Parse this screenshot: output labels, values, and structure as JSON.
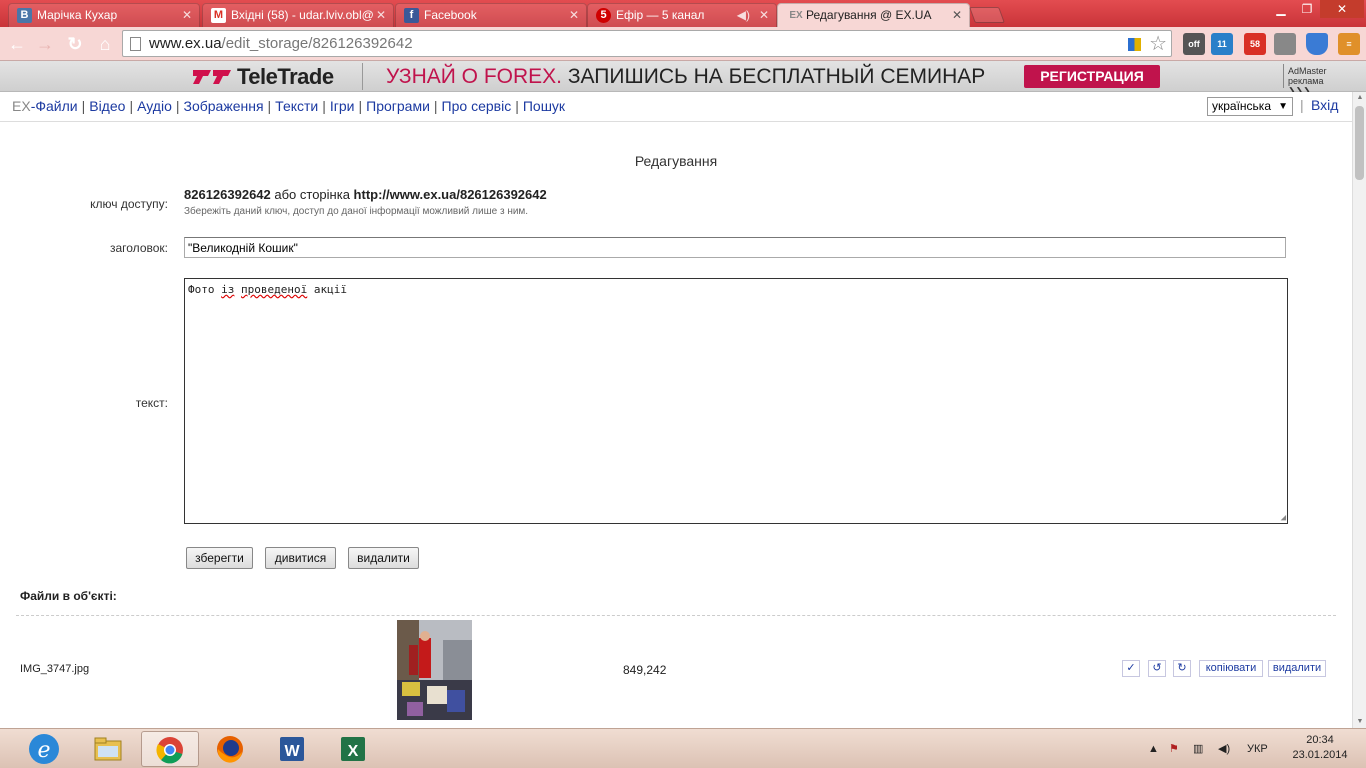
{
  "browser": {
    "tabs": [
      {
        "title": "Марічка Кухар",
        "icon": "vk-icon",
        "icon_color": "#4a76a8",
        "glyph": "B"
      },
      {
        "title": "Вхідні (58) - udar.lviv.obl@",
        "icon": "gmail-icon",
        "icon_color": "#d93025",
        "glyph": "M"
      },
      {
        "title": "Facebook",
        "icon": "facebook-icon",
        "icon_color": "#3b5998",
        "glyph": "f"
      },
      {
        "title": "Ефір — 5 канал",
        "icon": "5kanal-icon",
        "icon_color": "#d00000",
        "glyph": "5"
      },
      {
        "title": "Редагування @ EX.UA",
        "icon": "exua-icon",
        "icon_color": "#888888",
        "glyph": "EX"
      }
    ],
    "url_host": "www.ex.ua",
    "url_path": "/edit_storage/826126392642",
    "extensions": [
      {
        "label": "off",
        "color": "#555555"
      },
      {
        "label": "11",
        "color": "#2a7fc9"
      },
      {
        "label": "58",
        "color": "#d93025"
      },
      {
        "label": "",
        "color": "#888888"
      },
      {
        "label": "",
        "color": "#3a7bd5"
      },
      {
        "label": "",
        "color": "#e0902a"
      }
    ]
  },
  "banner": {
    "brand": "TeleTrade",
    "slogan_highlight": "УЗНАЙ О FOREX.",
    "slogan_rest": " ЗАПИШИСЬ НА БЕСПЛАТНЫЙ СЕМИНАР",
    "cta": "РЕГИСТРАЦИЯ",
    "network_line1": "AdMaster",
    "network_line2": "реклама"
  },
  "site_nav": {
    "brand": "EX",
    "items": [
      "-Файли",
      "Відео",
      "Аудіо",
      "Зображення",
      "Тексти",
      "Ігри",
      "Програми",
      "Про сервіс",
      "Пошук"
    ],
    "language": "українська",
    "login": "Вхід"
  },
  "edit_form": {
    "page_title": "Редагування",
    "access_key_label": "ключ доступу:",
    "access_key": "826126392642",
    "or_page": " або сторінка ",
    "page_url": "http://www.ex.ua/826126392642",
    "access_hint": "Збережіть даний ключ, доступ до даної інформації можливий лише з ним.",
    "title_label": "заголовок:",
    "title_value": "\"Великодній Кошик\"",
    "text_label": "текст:",
    "text_words": [
      "Фото",
      "із",
      "проведеної",
      "акції"
    ],
    "save_button": "зберегти",
    "view_button": "дивитися",
    "delete_button": "видалити"
  },
  "files": {
    "heading": "Файли в об'єкті:",
    "rows": [
      {
        "name": "IMG_3747.jpg",
        "size": "849,242",
        "check": "✓",
        "rotate_left": "↺",
        "rotate_right": "↻",
        "copy": "копіювати",
        "delete": "видалити"
      }
    ]
  },
  "taskbar": {
    "apps": [
      {
        "name": "explorer",
        "icon": "folder-icon"
      },
      {
        "name": "chrome",
        "icon": "chrome-icon",
        "active": true
      },
      {
        "name": "firefox",
        "icon": "firefox-icon"
      },
      {
        "name": "word",
        "icon": "word-icon"
      },
      {
        "name": "excel",
        "icon": "excel-icon"
      }
    ],
    "language": "УКР",
    "time": "20:34",
    "date": "23.01.2014"
  }
}
